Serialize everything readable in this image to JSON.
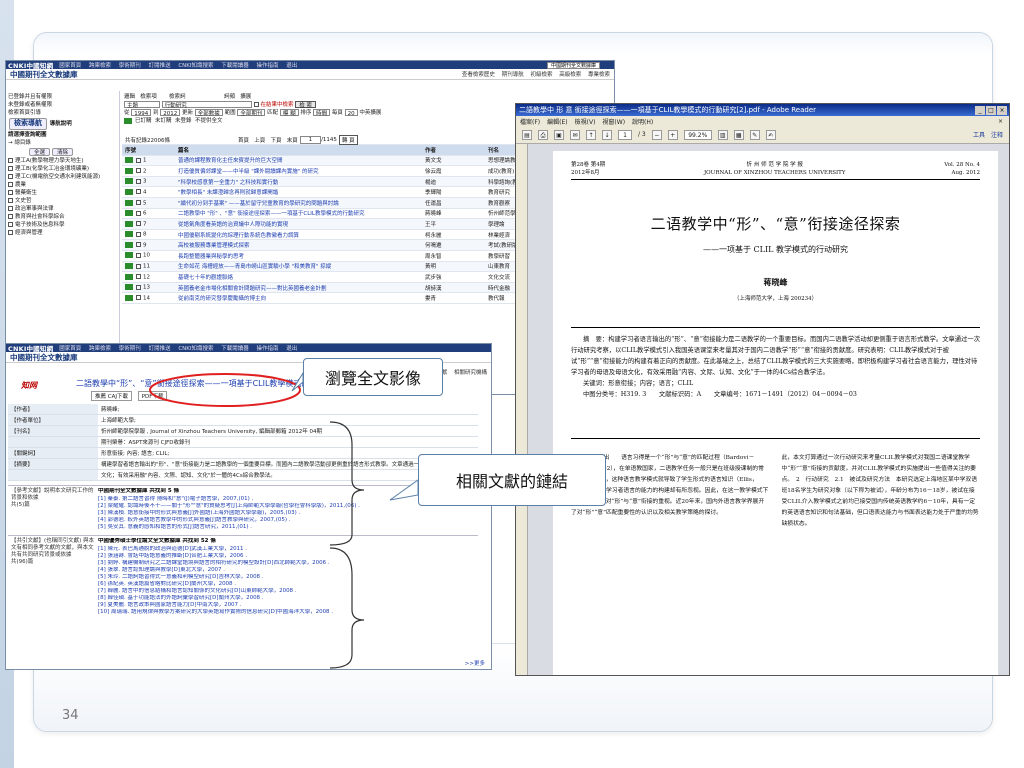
{
  "page_number": "34",
  "cnki": {
    "logo": "CNKI中國知網",
    "nav": [
      "國家首頁",
      "跨庫檢索",
      "學術期刊",
      "訂閱推送",
      "CNKI知識搜索",
      "下載閱讀器",
      "操作指南",
      "退出"
    ],
    "db_title": "中國期刊全文數據庫",
    "right_links": [
      "查看檢索歷史",
      "期刊導航",
      "初級檢索",
      "高級檢索",
      "專業檢索"
    ],
    "db_select": "中國期刊全文數據庫",
    "sidebar": {
      "top_items": [
        "已登錄并且有權限",
        "未登錄或者無權限",
        "檢索首頁引導"
      ],
      "search_nav": "檢索導航",
      "guide": "導航說明",
      "category_label": "請選擇查詢範圍",
      "all_label": "總目錄",
      "select_all": "全選",
      "clear": "清除",
      "categories": [
        "理工A(數學物理力學天地生)",
        "理工B(化學化工冶金環境礦業)",
        "理工C(機電航空交通水利建筑能源)",
        "農業",
        "醫藥衛生",
        "文史哲",
        "政治軍事與法律",
        "教育與社會科學綜合",
        "電子技術及信息科學",
        "經濟與管理"
      ]
    },
    "controls": {
      "logic_label": "邏輯",
      "item_label": "檢索項",
      "term_label": "檢索詞",
      "freq_label": "詞頻",
      "expand_label": "擴展",
      "item_value": "主題",
      "term_value": "行動研究",
      "search_in_results": "在結果中檢索",
      "search_btn": "檢 索",
      "from_label": "從",
      "year_from": "1994",
      "to_label": "到",
      "year_to": "2012",
      "update_label": "更新",
      "update_value": "全部數據",
      "range_label": "範圍",
      "range_value": "全部期刊",
      "match_label": "匹配",
      "match_value": "模 糊",
      "sort_label": "排序",
      "sort_value": "時間",
      "per_page_label": "每頁",
      "per_page_value": "20",
      "lang_label": "中英擴展",
      "legend": [
        "已訂購",
        "未訂購",
        "未登錄",
        "不提供全文"
      ]
    },
    "results": {
      "count_text": "共有記錄22006條",
      "pager": [
        "首頁",
        "上頁",
        "下頁",
        "末頁"
      ],
      "page_value": "1",
      "page_total": "/1145",
      "go_btn": "轉 頁",
      "actions": [
        "全選",
        "清除",
        "存 盤"
      ],
      "headers": [
        "序號",
        "篇名",
        "作者",
        "刊名"
      ],
      "rows": [
        {
          "num": "1",
          "title": "普通的課程教育化主任來賓提升的巨大空間",
          "author": "黃文戈",
          "journal": "思想理論教"
        },
        {
          "num": "2",
          "title": "打造優質偏郊課堂——中半級 \"課外閱讀課內實施\" 的研究",
          "author": "徐云霞",
          "journal": "成功(教育)"
        },
        {
          "num": "3",
          "title": "\"科學校感意第一全重力\" 之科技和實行動",
          "author": "楊迪",
          "journal": "科學諮詢(教"
        },
        {
          "num": "4",
          "title": "\"數學相長\" 未課澄歸念再則就歸意課開諧",
          "author": "季輝陽",
          "journal": "教育研究"
        },
        {
          "num": "5",
          "title": "\"續代初分到手基案\" ——基於留守兒童教育的學研究的問題與討論",
          "author": "任運昌",
          "journal": "教育觀察"
        },
        {
          "num": "6",
          "title": "二語教學中 \"形\" 、\"意\" 銜接途徑探索——一項基于CLIL教學模式的行動研究",
          "author": "蔣曉峰",
          "journal": "忻州師范學"
        },
        {
          "num": "7",
          "title": "從語氣角度看英語的治資議中人際功能的實現",
          "author": "王平",
          "journal": "學理論"
        },
        {
          "num": "8",
          "title": "中國優剔系統變化的綜理行動系統色教徽看力調算",
          "author": "柯永麗",
          "journal": "林業經濟"
        },
        {
          "num": "9",
          "title": "高校被服務專業管理模式探索",
          "author": "何鳴遷",
          "journal": "考試(教研版"
        },
        {
          "num": "10",
          "title": "長跑整體器業與秘學的思考",
          "author": "周永智",
          "journal": "教學研習"
        },
        {
          "num": "11",
          "title": "生命如花 海槽經放——青島市嶗山區實驗小學 \"和美教育\" 掠縱",
          "author": "黃明",
          "journal": "山東教育"
        },
        {
          "num": "12",
          "title": "基礎七十年的觀證脈絡",
          "author": "武步強",
          "journal": "文化交流"
        },
        {
          "num": "13",
          "title": "英國養老金市場化相關會計問題研究——對比英國養老金計劃",
          "author": "胡詩漢",
          "journal": "時代金融"
        },
        {
          "num": "14",
          "title": "從前南克的研究發學慶勵攝的博主向",
          "author": "婁青",
          "journal": "教代報"
        }
      ]
    }
  },
  "reader": {
    "title": "二語教學中 形 意 銜接途徑探索——一項基于CLIL教學模式的行動研究[2].pdf - Adobe Reader",
    "menu": [
      "檔案(F)",
      "編輯(E)",
      "檢視(V)",
      "視窗(W)",
      "說明(H)"
    ],
    "page_current": "1",
    "page_total": "/ 3",
    "zoom": "99.2%",
    "tools": "工具",
    "comments": "注释",
    "paper": {
      "vol_issue": "第28卷  第4期",
      "date_cn": "2012年8月",
      "journal_cn": "忻 州 师 范 学 院 学 报",
      "journal_en": "JOURNAL OF XINZHOU TEACHERS UNIVERSITY",
      "vol_en": "Vol. 28  No. 4",
      "date_en": "Aug. 2012",
      "title": "二语教学中“形”、“意”衔接途径探索",
      "subtitle": "——一项基于 CLIL 教学模式的行动研究",
      "author": "蒋晓峰",
      "affiliation": "（上海师范大学，上海 200234）",
      "abstract": "摘　要：构建学习者语言输出的“形”、“意”衔接能力是二语教学的一个重要目标。而国内二语教学活动却更侧重于语言形式教学。文章通过一次行动研究考察，以CLIL教学模式引入我国英语课堂来考量其对于国内二语教学“形”“意”衔接的贡献度。研究表明：CLIL教学模式对于被试“形”“意”衔接能力的构建有着正向的贡献度。在此基础之上，总结了CLIL教学模式的三大实施要略，即积极构建学习者社会语言能力，理性对待学习者的母语及母语文化，有效采用融“内容、文际、认知、文化”于一体的4Cs综合教学法。",
      "keywords": "关键词：形意衔接；内容；语言；CLIL",
      "classification": "中图分类号：H319. 3　　文献标识码：A　　文章编号：1671－1491（2012）04－0094－03",
      "col1": "1　问题的提出　　语言习得是一个“形”与“意”的匹配过程（Bardovi－Harlig，1992），在单语教国家，二语教学任务一般只是在班级授课制的常态背景下进行，这种语言教学模式就导致了学生形式的语言知识（Ellis，1999），而对学习者语言的能力的构建却有所忽视。因此，在这一教学模式下教学可能缺乏对“形”与“意”衔接的重视。近20年来，国内外语言教学界展开了对“形”“意”匹配重要性的认识以及相关教学策略的探讨。",
      "col2": "此，本文打算通过一次行动研究来考量CLIL教学模式对我国二语课堂教学中“形”“意”衔接的贡献度，并对CLIL教学模式的实施提出一些值得关注的要点。　2　行动研究　2.1　被试及研究方法　本研究选定上海地区某中学双语班18名学生为研究对象（以下称为被试），年龄分布为16－18岁，被试在接受CLIL介入教学模式之前均已接受国内传统英语教学约6－10年，具有一定的英语语言知识和句法基础，但口语表达能力与书面表达能力处于严重的均势缺损状态。"
    }
  },
  "detail": {
    "title": "二語教學中“形”、“意”銜接途徑探索——一項基于CLIL教學模式的行動研究",
    "download_caj": "推薦 CAJ下載",
    "download_pdf": "PDF下載",
    "right_links": [
      "相似文獻",
      "相關研究機構"
    ],
    "info": [
      {
        "label": "【作者】",
        "value": "蔣曉峰;"
      },
      {
        "label": "【作者單位】",
        "value": "上海師範大學;"
      },
      {
        "label": "【刊名】",
        "value": "忻州師範學院學報 , Journal of Xinzhou Teachers University, 編輯部郵箱 2012年 04期"
      },
      {
        "label": "",
        "value": "期刊榮譽：ASPT來源刊  CJFD收錄刊"
      },
      {
        "label": "【關鍵詞】",
        "value": "形意銜接; 內容; 語言; CLIL;"
      },
      {
        "label": "【摘要】",
        "value": "構建學習者語言輸出的\"形\"、\"意\"銜接能力是二語教學的一個重要目標。而國內二語教學活動卻更側重於語言形式教學。文章通過一次行動研究考察，以CLIL教學模式引入我國英語課堂來考量其對於國內二語教學\"形\"\"意\"銜接的貢獻度。研究表明：CLIL教學模式對於被試\"形\"\"意\"銜接能力的構建有著正向的貢獻度。在此基礎之上，總結了CLIL教學模式的三大實施要略。"
      },
      {
        "label": "",
        "value": "文化；有效采用融\"內容、文際、認知、文化\"於一體的4Cs綜合教學法。"
      }
    ],
    "ref_groups": [
      {
        "label": "【參考文獻】說明本文研究工作的背景和依據",
        "count": "共(5)篇",
        "heading": "中國期刊全文數據庫 共找到 5 條",
        "items": [
          "[1] 秦蓁. 第二語言習得 隱晦和\"意\"(J)電子語言學，2007,(01) .",
          "[2] 梁耀耀. 認識時後不十——關于\"形\"\"意\"的質疑思考[J]上海師範大學學報(哲學社會科學版)，2011,(06) .",
          "[3] 陳漢楨. 語意銜接中的形式與意義[J]外國語(上海外國語大學學報)，2005,(03) .",
          "[4] 郭德岩. 較外英語語言教學中的形式與意義[J]語言教學與研究，2007,(05) .",
          "[5] 吳安其. 意義的感知和語言的形式[J]語言研究，2011,(01) ."
        ]
      },
      {
        "label": "【共引文獻】(也稱同引文獻) 與本文有相同參考文獻的文獻，與本文共有共同研究背景或依據",
        "count": "共(96)篇",
        "heading": "中國優秀碩士學位論文全文數據庫 共找到 52 條",
        "items": [
          "[1] 陳元. 表巴馬通脫的政治與道德[D]武漢工業大學，2011 .",
          "[2] 張涵蒔. 會話中話語意義的推斷[D]合肥工業大學，2006 .",
          "[3] 劉婷. 構建機制研究之二語課堂語境與語言的相符研究的模型設計[D]西北師範大學，2006 .",
          "[4] 張翠. 語言認知理論與教學[D]東北大學，2007 .",
          "[5] 朱玲. 二語詞語習得式一意義和利模型研究[D]吉林大學，2008 .",
          "[6] 孫紀英. 英漢語篇省略對比研究[D]蘭州大學，2008 .",
          "[7] 韓麗. 語言中的信息結構和語言認知關係的文化研究[D]山東師範大學，2008 .",
          "[8] 韓佳碩. 基于功能語法的外語詞彙學習研究[D]蘭州大學，2008 .",
          "[9] 夏美麗. 語言政策與國家語言能力[D]中南大學，2007 .",
          "[10] 周瑞瑞. 語用規律與教學方案研究的大學英語寫作實際的信息研究[D]中國海洋大學，2008 ."
        ]
      }
    ],
    "more": ">>更多"
  },
  "callouts": {
    "browse": "瀏覽全文影像",
    "links": "相關文獻的鏈結"
  }
}
